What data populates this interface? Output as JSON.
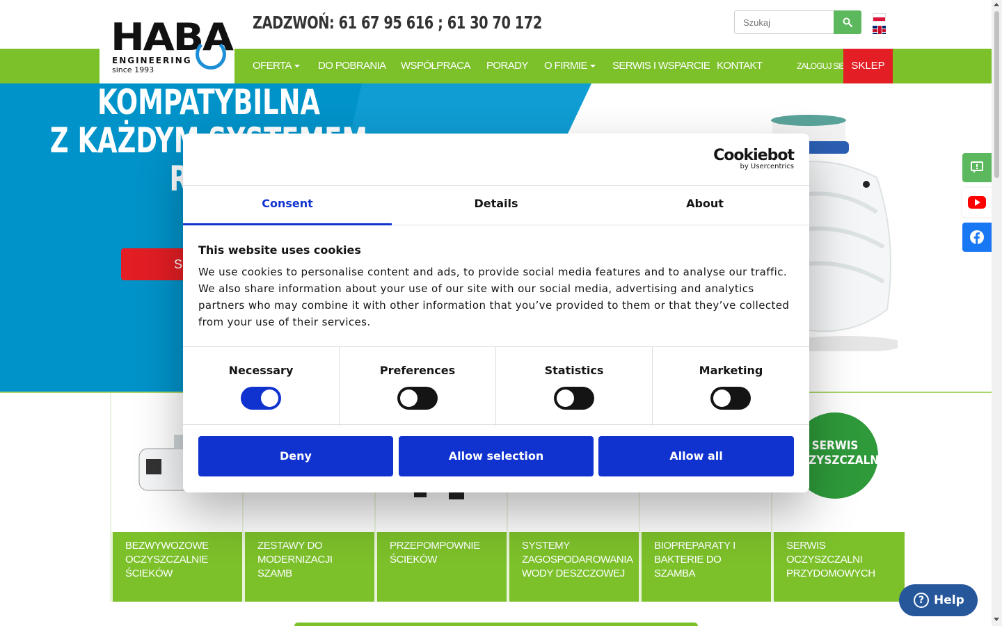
{
  "header": {
    "logo": {
      "main": "HABA",
      "sub": "ENGINEERING",
      "since": "since 1993"
    },
    "phone": "ZADZWOŃ: 61 67 95 616 ; 61 30 70 172",
    "search_placeholder": "Szukaj",
    "languages": [
      "pl",
      "en"
    ]
  },
  "nav": {
    "items": [
      {
        "label": "OFERTA",
        "dropdown": true
      },
      {
        "label": "DO POBRANIA",
        "dropdown": false
      },
      {
        "label": "WSPÓŁPRACA",
        "dropdown": false
      },
      {
        "label": "PORADY",
        "dropdown": false
      },
      {
        "label": "O FIRMIE",
        "dropdown": true
      },
      {
        "label": "SERWIS I WSPARCIE",
        "dropdown": false
      },
      {
        "label": "KONTAKT",
        "dropdown": false
      }
    ],
    "login": "ZALOGUJ SIĘ",
    "shop": "SKLEP"
  },
  "hero": {
    "title_lines": [
      "KOMPATYBILNA",
      "Z KAŻDYM SYSTEMEM",
      "ROZS"
    ],
    "button_label": "SP"
  },
  "products": [
    {
      "label": "BEZWYWOZOWE OCZYSZCZALNIE ŚCIEKÓW"
    },
    {
      "label": "ZESTAWY DO MODERNIZACJI SZAMB"
    },
    {
      "label": "PRZEPOMPOWNIE ŚCIEKÓW"
    },
    {
      "label": "SYSTEMY ZAGOSPODAROWANIA WODY DESZCZOWEJ"
    },
    {
      "label": "BIOPREPARATY I BAKTERIE DO SZAMBA"
    },
    {
      "label": "SERWIS OCZYSZCZALNI PRZYDOMOWYCH"
    }
  ],
  "serwis_badge": {
    "line1": "SERWIS",
    "line2": "OCZYSZCZALNI"
  },
  "side_social": [
    "feedback-icon",
    "youtube-icon",
    "facebook-icon"
  ],
  "cookie_dialog": {
    "brand": "Cookiebot",
    "brand_sub": "by Usercentrics",
    "tabs": [
      "Consent",
      "Details",
      "About"
    ],
    "active_tab": "Consent",
    "title": "This website uses cookies",
    "text": "We use cookies to personalise content and ads, to provide social media features and to analyse our traffic. We also share information about your use of our site with our social media, advertising and analytics partners who may combine it with other information that you’ve provided to them or that they’ve collected from your use of their services.",
    "switches": [
      {
        "label": "Necessary",
        "on": true
      },
      {
        "label": "Preferences",
        "on": false
      },
      {
        "label": "Statistics",
        "on": false
      },
      {
        "label": "Marketing",
        "on": false
      }
    ],
    "buttons": {
      "deny": "Deny",
      "allow_selection": "Allow selection",
      "allow_all": "Allow all"
    }
  },
  "help_button": "Help",
  "colors": {
    "green": "#7cc02a",
    "red": "#e31e24",
    "blue": "#0093c9",
    "cookie_blue": "#1032cf",
    "help_blue": "#26579b"
  }
}
